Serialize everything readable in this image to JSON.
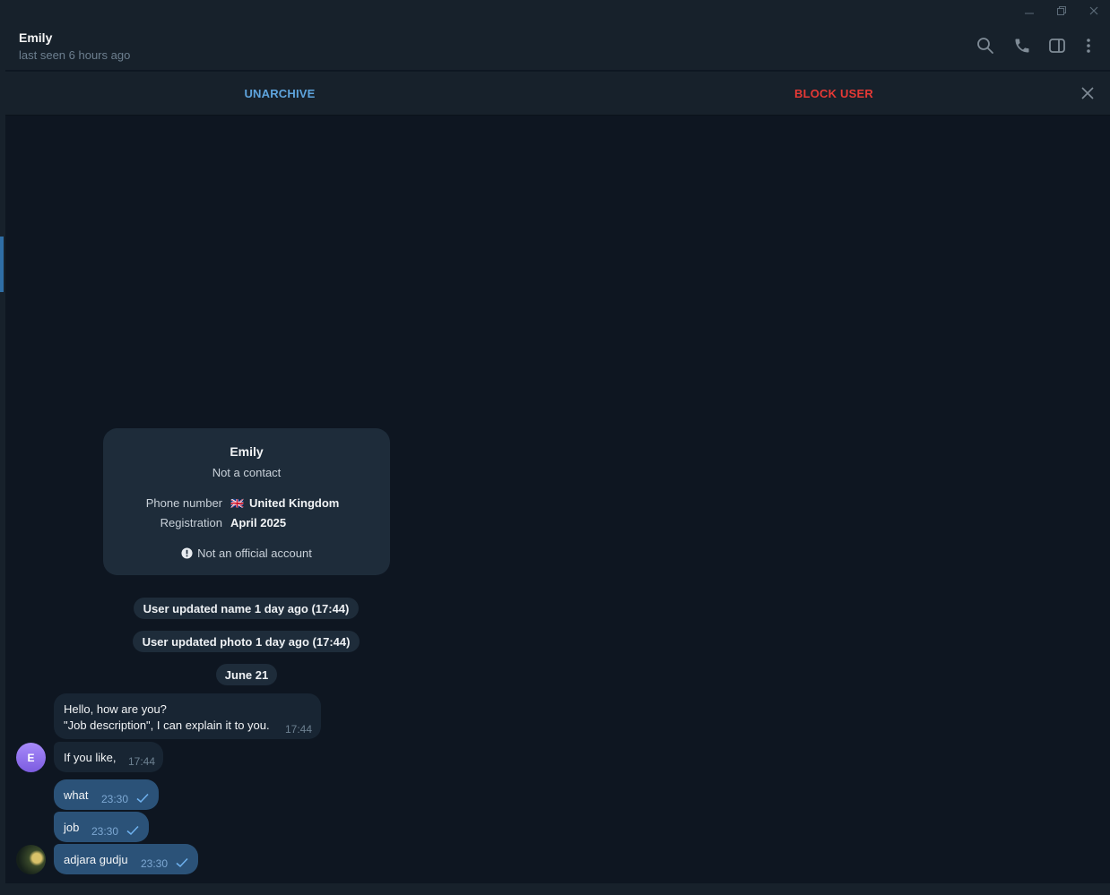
{
  "window": {
    "minimize_glyph": "–",
    "restore_glyph": "❐",
    "close_glyph": "✕"
  },
  "header": {
    "name": "Emily",
    "status": "last seen 6 hours ago",
    "icons": [
      "search-icon",
      "phone-icon",
      "sidebar-toggle-icon",
      "more-vertical-icon"
    ]
  },
  "actions": {
    "unarchive": "UNARCHIVE",
    "block": "BLOCK USER",
    "close_icon": "close-icon"
  },
  "colors": {
    "accent_blue": "#5ea4dd",
    "danger_red": "#e53935",
    "background": "#0e1621",
    "panel": "#17212b",
    "outgoing_bubble": "#2b5278",
    "incoming_bubble": "#182533"
  },
  "profile_card": {
    "name": "Emily",
    "subtitle": "Not a contact",
    "phone_label": "Phone number",
    "phone_flag": "🇬🇧",
    "phone_value": "United Kingdom",
    "registration_label": "Registration",
    "registration_value": "April 2025",
    "notice": "Not an official account"
  },
  "service_messages": [
    "User updated name 1 day ago (17:44)",
    "User updated photo 1 day ago (17:44)"
  ],
  "date_divider": "June 21",
  "messages": [
    {
      "direction": "in",
      "lines": [
        "Hello, how are you?",
        "\"Job description\", I can explain it to you."
      ],
      "time": "17:44"
    },
    {
      "direction": "in",
      "lines": [
        "If you like,"
      ],
      "time": "17:44"
    },
    {
      "direction": "out",
      "lines": [
        "what"
      ],
      "time": "23:30",
      "status": "sent"
    },
    {
      "direction": "out",
      "lines": [
        "job"
      ],
      "time": "23:30",
      "status": "sent"
    },
    {
      "direction": "out",
      "lines": [
        "adjara gudju"
      ],
      "time": "23:30",
      "status": "sent"
    }
  ],
  "avatars": {
    "emily_initial": "E"
  }
}
